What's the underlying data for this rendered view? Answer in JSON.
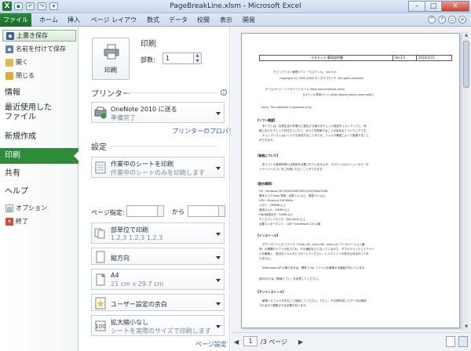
{
  "window": {
    "title": "PageBreakLine.xlsm - Microsoft Excel",
    "app_icon": "X"
  },
  "ribbon": {
    "file_tab": "ファイル",
    "tabs": [
      "ホーム",
      "挿入",
      "ページ レイアウト",
      "数式",
      "データ",
      "校閲",
      "表示",
      "開発"
    ]
  },
  "sidebar": {
    "save_overwrite": "上書き保存",
    "save_as": "名前を付けて保存",
    "open": "開く",
    "close": "閉じる",
    "info": "情報",
    "recent_line1": "最近使用した",
    "recent_line2": "ファイル",
    "new": "新規作成",
    "print": "印刷",
    "share": "共有",
    "help": "ヘルプ",
    "options": "オプション",
    "exit": "終了"
  },
  "print": {
    "button_label": "印刷",
    "section_title": "印刷",
    "copies_label": "部数:",
    "copies_value": "1"
  },
  "printer": {
    "section_title": "プリンター",
    "name": "OneNote 2010 に送る",
    "status": "準備完了",
    "properties_link": "プリンターのプロパティ"
  },
  "settings": {
    "section_title": "設定",
    "what_to_print": "作業中のシートを印刷",
    "what_to_print_desc": "作業中のシートのみを印刷します",
    "pages_label": "ページ指定:",
    "pages_to_label": "から",
    "collation": "部単位で印刷",
    "collation_desc": "1,2,3    1,2,3    1,2,3",
    "orientation": "縦方向",
    "paper_size": "A4",
    "paper_dims": "21 cm x 29.7 cm",
    "margins": "ユーザー設定の余白",
    "scaling": "拡大縮小なし",
    "scaling_desc": "シートを実際のサイズで印刷します",
    "page_setup_link": "ページ設定"
  },
  "preview": {
    "header_title": "ラスティル 簡易説明書",
    "header_ver": "Ver3.0",
    "header_date": "2010/2/31",
    "intro_line1": "チェックリスト管理ソフト「ラスティル」 Ver 3.0",
    "intro_line2": "Copyright (C) 2005-2008 ホノダラコウイチ. All rights reserved",
    "intro_line3": "ホームページ : ソーサリーフォース  (http://sorceryforce.com/)",
    "intro_line4": "ラスティル専用ページ  (http://sorceryforce.com/rustil/)",
    "intro_line5": "Sorry. This software is Japanese only.",
    "sec1": "【ソフト概要】",
    "sec1_l1": "本ソフトは、日常生活や作業の工程などで様々なチェック項目をリストアップし、判",
    "sec1_l2": "断にありたチェックを付けていたり、タスクを簡単することが出来るソフトウェアです。",
    "sec1_l3": "チェックリストはいくつでも作成することができ、フォルダ構成によって管理すること",
    "sec1_l4": "ができます。",
    "sec2": "【価格について】",
    "sec2_l1": "本ソフトの使用料等には費用を必要されていませんが、ラスティルのメニューから「オ",
    "sec2_l2": "ンラインヘルプ」をご利用いただくことができます。",
    "sec3": "【動作環境】",
    "env_os": "OS                    : Windows 98 SE/Me/2000/XP/2003/Vista/2008",
    "env_score": "基本スコアVista 専用 : 全般 1.0 以上、推奨 2.0 以上",
    "env_cpu": "CPU                   : Pentium II 600MHz",
    "env_mem": "メモリ                : 256MB 以上",
    "env_hdd": "使用スキル            : 50MB 以上",
    "env_hdd2": "HDD使用空き          : 50MB 以上",
    "env_disp": "ディスプレイサイズ    : 800×600 以上",
    "env_net": "必要コンポーネント    : .NET Framework 2.0 以降",
    "sec4": "【インストール】",
    "sec4_l1": "ダウンロードしたファイル（rustil_ver_xxxx.zip）(xxxx はソフトのバージョン番",
    "sec4_l2": "号）の展開のソフトが出力され、その通知などになっているので、ダブルクリックしてファイ",
    "sec4_l3": "ルを解凍し、適当なフォルダにコピーしてください。レジストリへの書き込みは行ってお",
    "sec4_l4": "りません。",
    "sec4_l5": "※Windows XP 以降であれば、標準で zip ファイルを解凍する機能が付いています。",
    "sec4_l6": "他のOSでは「解凍ソフト」を用意してください。",
    "sec5": "【アンインストール】",
    "sec5_l1": "解凍したフォルダを丸ごと削除してください。ただし、その際作成したデータは削除",
    "sec5_l2": "されるので移動させる必要があります。"
  },
  "pagebar": {
    "current": "1",
    "total": "/3 ページ"
  }
}
